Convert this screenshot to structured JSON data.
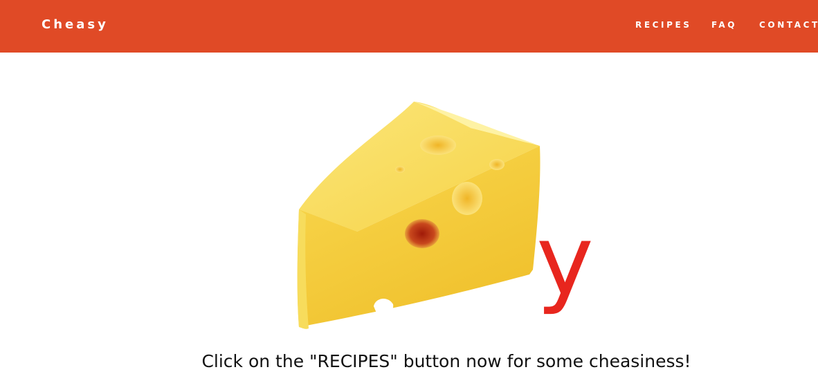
{
  "navbar": {
    "brand": "Cheasy",
    "background_color": "#e04a26",
    "links": [
      {
        "label": "RECIPES"
      },
      {
        "label": "FAQ"
      },
      {
        "label": "CONTACT"
      }
    ]
  },
  "hero": {
    "logo_image": "cheese-wedge",
    "logo_letter": "y",
    "letter_color": "#e8261e"
  },
  "main": {
    "tagline": "Click on the \"RECIPES\" button now for some cheasiness!"
  }
}
